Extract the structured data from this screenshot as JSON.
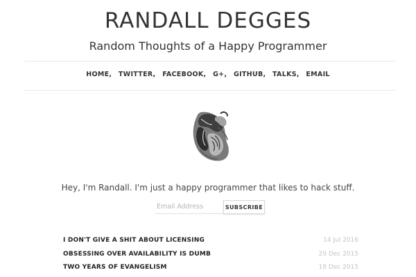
{
  "header": {
    "title": "RANDALL DEGGES",
    "tagline": "Random Thoughts of a Happy Programmer"
  },
  "nav": {
    "items": [
      {
        "label": "HOME,"
      },
      {
        "label": "TWITTER,"
      },
      {
        "label": "FACEBOOK,"
      },
      {
        "label": "G+,"
      },
      {
        "label": "GITHUB,"
      },
      {
        "label": "TALKS,"
      },
      {
        "label": "EMAIL"
      }
    ]
  },
  "avatar": {
    "icon": "sketch-avatar-icon"
  },
  "intro": {
    "text": "Hey, I'm Randall. I'm just a happy programmer that likes to hack stuff."
  },
  "subscribe": {
    "placeholder": "Email Address",
    "button_label": "SUBSCRIBE"
  },
  "posts": [
    {
      "title": "I DON'T GIVE A SHIT ABOUT LICENSING",
      "date": "14 Jul 2016"
    },
    {
      "title": "OBSESSING OVER AVAILABILITY IS DUMB",
      "date": "29 Dec 2015"
    },
    {
      "title": "TWO YEARS OF EVANGELISM",
      "date": "18 Dec 2015"
    }
  ],
  "colors": {
    "text": "#333333",
    "muted_date": "#c4c4c4",
    "rule": "#ebebeb"
  }
}
